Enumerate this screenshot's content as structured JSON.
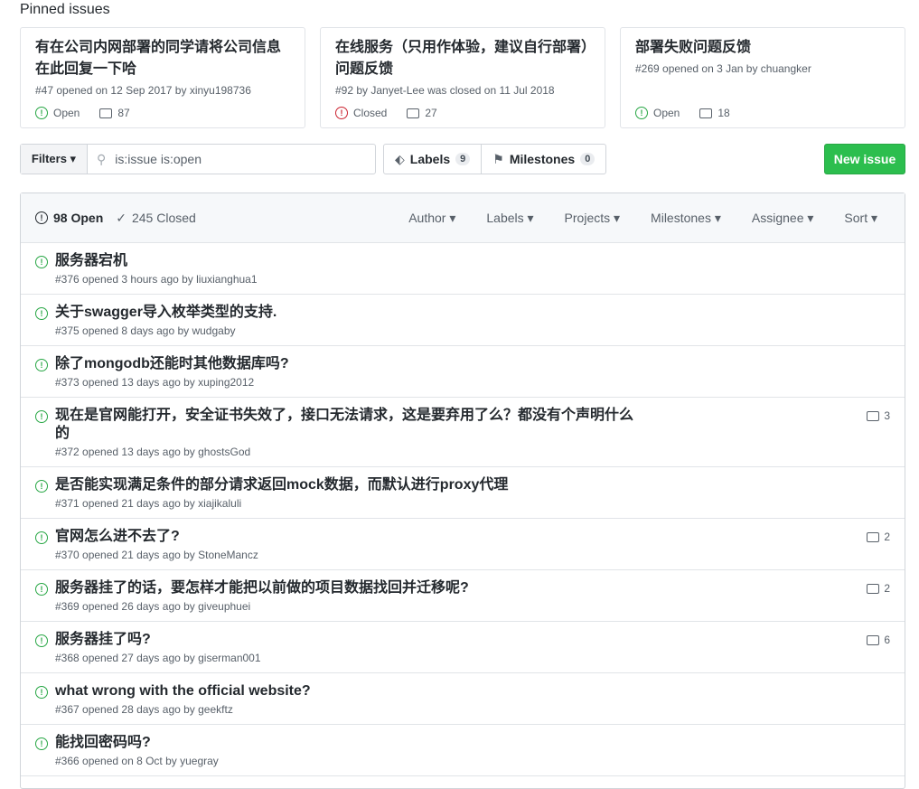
{
  "pinned": {
    "heading": "Pinned issues",
    "cards": [
      {
        "title": "有在公司内网部署的同学请将公司信息在此回复一下哈",
        "meta": "#47 opened on 12 Sep 2017 by xinyu198736",
        "state": "Open",
        "comments": "87"
      },
      {
        "title": "在线服务（只用作体验，建议自行部署）问题反馈",
        "meta": "#92 by Janyet-Lee was closed on 11 Jul 2018",
        "state": "Closed",
        "comments": "27"
      },
      {
        "title": "部署失败问题反馈",
        "meta": "#269 opened on 3 Jan by chuangker",
        "state": "Open",
        "comments": "18"
      }
    ]
  },
  "toolbar": {
    "filters": "Filters ▾",
    "search_value": "is:issue is:open",
    "labels": "Labels",
    "labels_count": "9",
    "milestones": "Milestones",
    "milestones_count": "0",
    "new_issue": "New issue"
  },
  "list_header": {
    "open": "98 Open",
    "closed": "245 Closed",
    "menus": [
      "Author ▾",
      "Labels ▾",
      "Projects ▾",
      "Milestones ▾",
      "Assignee ▾",
      "Sort ▾"
    ]
  },
  "issues": [
    {
      "title": "服务器宕机",
      "meta": "#376 opened 3 hours ago by liuxianghua1",
      "comments": ""
    },
    {
      "title": "关于swagger导入枚举类型的支持.",
      "meta": "#375 opened 8 days ago by wudgaby",
      "comments": ""
    },
    {
      "title": "除了mongodb还能时其他数据库吗?",
      "meta": "#373 opened 13 days ago by xuping2012",
      "comments": ""
    },
    {
      "title": "现在是官网能打开，安全证书失效了，接口无法请求，这是要弃用了么？都没有个声明什么的",
      "meta": "#372 opened 13 days ago by ghostsGod",
      "comments": "3"
    },
    {
      "title": "是否能实现满足条件的部分请求返回mock数据，而默认进行proxy代理",
      "meta": "#371 opened 21 days ago by xiajikaluli",
      "comments": ""
    },
    {
      "title": "官网怎么进不去了?",
      "meta": "#370 opened 21 days ago by StoneMancz",
      "comments": "2"
    },
    {
      "title": "服务器挂了的话，要怎样才能把以前做的项目数据找回并迁移呢?",
      "meta": "#369 opened 26 days ago by giveuphuei",
      "comments": "2"
    },
    {
      "title": "服务器挂了吗?",
      "meta": "#368 opened 27 days ago by giserman001",
      "comments": "6"
    },
    {
      "title": "what wrong with the official website?",
      "meta": "#367 opened 28 days ago by geekftz",
      "comments": ""
    },
    {
      "title": "能找回密码吗?",
      "meta": "#366 opened on 8 Oct by yuegray",
      "comments": ""
    }
  ]
}
